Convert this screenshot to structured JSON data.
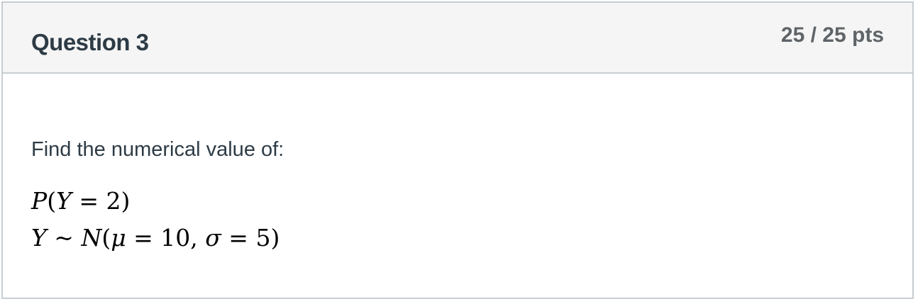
{
  "question": {
    "title": "Question 3",
    "points": "25 / 25 pts",
    "prompt": "Find the numerical value of:",
    "math": {
      "line1": {
        "P": "P",
        "open": "(",
        "Y": "Y",
        "eq": " = ",
        "value": "2",
        "close": ")"
      },
      "line2": {
        "Y": "Y",
        "tilde": " ~ ",
        "N": "N",
        "open": "(",
        "mu": "μ",
        "eq1": " = ",
        "mu_value": "10",
        "comma": ", ",
        "sigma": "σ",
        "eq2": " = ",
        "sigma_value": "5",
        "close": ")"
      }
    }
  }
}
